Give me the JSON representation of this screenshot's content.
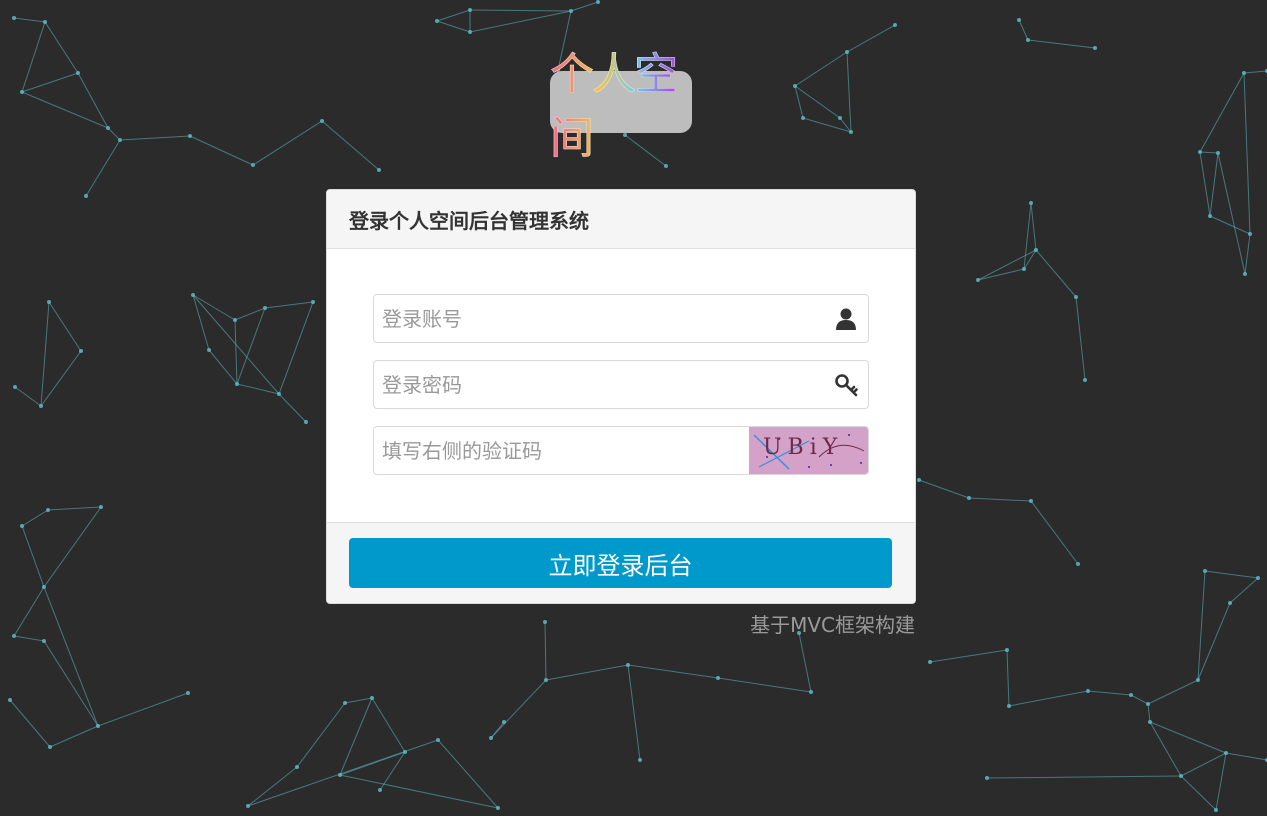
{
  "logo": {
    "text": "个人空间"
  },
  "panel": {
    "title": "登录个人空间后台管理系统"
  },
  "form": {
    "account_placeholder": "登录账号",
    "password_placeholder": "登录密码",
    "captcha_placeholder": "填写右侧的验证码",
    "captcha_text": "UBiY"
  },
  "icons": {
    "account": "user-icon",
    "password": "key-icon"
  },
  "button": {
    "label": "立即登录后台"
  },
  "footer": {
    "credit": "基于MVC框架构建"
  },
  "colors": {
    "background": "#2b2b2b",
    "accent": "#0099cc",
    "network": "#5fb8c2"
  }
}
